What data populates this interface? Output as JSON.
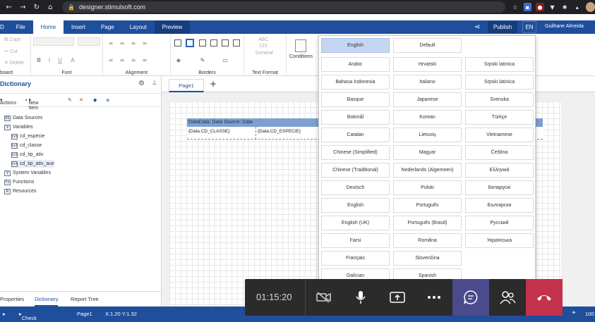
{
  "browser": {
    "url": "designer.stimulsoft.com"
  },
  "header": {
    "tabs": [
      {
        "label": "File"
      },
      {
        "label": "Home"
      },
      {
        "label": "Insert"
      },
      {
        "label": "Page"
      },
      {
        "label": "Layout"
      },
      {
        "label": "Preview"
      }
    ],
    "publish_label": "Publish",
    "lang_label": "EN",
    "user_name": "Guilhane Almeida"
  },
  "ribbon": {
    "copy_label": "Copy",
    "cut_label": "Cut",
    "delete_label": "Delete",
    "clipboard_label": "board",
    "font_label": "Font",
    "alignment_label": "Alignment",
    "borders_label": "Borders",
    "textformat_label": "Text Format",
    "general_label": "General",
    "abc_label": "ABC",
    "num_label": "123",
    "conditions_label": "Conditions"
  },
  "dictionary": {
    "title": "Dictionary",
    "actions_label": "Actions",
    "new_item_label": "New Item",
    "tree": [
      {
        "label": "Data Sources",
        "icon": "DS"
      },
      {
        "label": "Variables",
        "icon": "V"
      },
      {
        "label": "cd_especie",
        "icon": "txt"
      },
      {
        "label": "cd_classe",
        "icon": "txt"
      },
      {
        "label": "cd_tip_ativ",
        "icon": "txt"
      },
      {
        "label": "cd_tip_ativ_aux",
        "icon": "txt"
      },
      {
        "label": "System Variables",
        "icon": "V"
      },
      {
        "label": "Functions",
        "icon": "fx"
      },
      {
        "label": "Resources",
        "icon": "R"
      }
    ],
    "bottom_tabs": [
      "Properties",
      "Dictionary",
      "Report Tree"
    ]
  },
  "canvas": {
    "page_tab": "Page1",
    "band_header": "DataData; Data Source: Data",
    "cell_1": "{Data.CD_CLASSE}",
    "cell_2": "{Data.CD_ESPECIE}"
  },
  "languages": {
    "top_row": [
      "English",
      "Default"
    ],
    "grid": [
      [
        "Arabic",
        "Hrvatski",
        "Srpski latinica"
      ],
      [
        "Bahasa Indonesia",
        "Italiano",
        "Srpski latinica"
      ],
      [
        "Basque",
        "Japanese",
        "Svenska"
      ],
      [
        "Bokmål",
        "Korean",
        "Türkçe"
      ],
      [
        "Catalan",
        "Lietuvių",
        "Vietnamese"
      ],
      [
        "Chinese (Simplified)",
        "Magyar",
        "Čeština"
      ],
      [
        "Chinese (Traditional)",
        "Nederlands (Algemeen)",
        "Ελληνικά"
      ],
      [
        "Deutsch",
        "Polski",
        "Беларускі"
      ],
      [
        "English",
        "Português",
        "Български"
      ],
      [
        "English (UK)",
        "Português (Brasil)",
        "Русский"
      ],
      [
        "Farsi",
        "Româna",
        "Українська"
      ],
      [
        "Français",
        "Slovenčina",
        ""
      ],
      [
        "Galician",
        "Spanish",
        ""
      ]
    ]
  },
  "status": {
    "check_issues": "Check for Issues",
    "page": "Page1",
    "coords": "X:1.20 Y:1.32",
    "zoom_plus": "+",
    "zoom": "100"
  },
  "meeting": {
    "time": "01:15:20"
  },
  "colors": {
    "brand": "#1f4e9c",
    "hangup": "#c4314b",
    "chat": "#4b4a8c"
  }
}
